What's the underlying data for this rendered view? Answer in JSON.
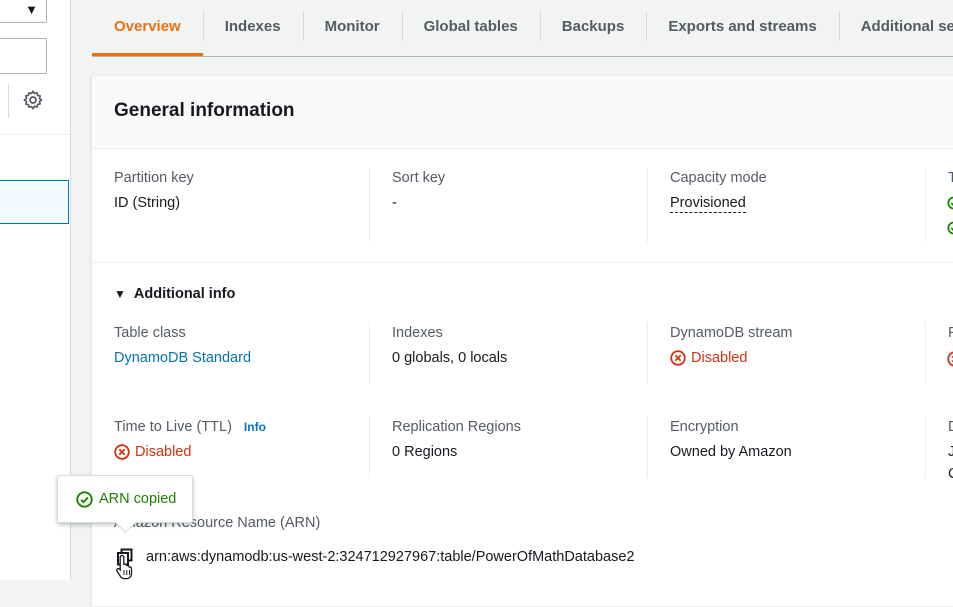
{
  "tabs": [
    {
      "label": "Overview",
      "active": true
    },
    {
      "label": "Indexes"
    },
    {
      "label": "Monitor"
    },
    {
      "label": "Global tables"
    },
    {
      "label": "Backups"
    },
    {
      "label": "Exports and streams"
    },
    {
      "label": "Additional settings"
    }
  ],
  "general": {
    "title": "General information",
    "partition_key_label": "Partition key",
    "partition_key_value": "ID (String)",
    "sort_key_label": "Sort key",
    "sort_key_value": "-",
    "capacity_mode_label": "Capacity mode",
    "capacity_mode_value": "Provisioned",
    "col4_label_partial": "T"
  },
  "additional_info": {
    "toggle_label": "Additional info",
    "table_class_label": "Table class",
    "table_class_value": "DynamoDB Standard",
    "indexes_label": "Indexes",
    "indexes_value": "0 globals, 0 locals",
    "stream_label": "DynamoDB stream",
    "stream_value": "Disabled",
    "col4_label_partial": "P",
    "ttl_label": "Time to Live (TTL)",
    "ttl_info": "Info",
    "ttl_value": "Disabled",
    "replication_label": "Replication Regions",
    "replication_value": "0 Regions",
    "encryption_label": "Encryption",
    "encryption_value": "Owned by Amazon",
    "col4_row2_label_partial": "D",
    "col4_row2_line1_partial": "J",
    "col4_row2_line2_partial": "C"
  },
  "arn": {
    "label": "Amazon Resource Name (ARN)",
    "value": "arn:aws:dynamodb:us-west-2:324712927967:table/PowerOfMathDatabase2"
  },
  "popover": {
    "text": "ARN copied"
  },
  "colors": {
    "accent": "#ec7211",
    "link": "#0073bb",
    "error": "#d13212",
    "success": "#1d8102"
  }
}
